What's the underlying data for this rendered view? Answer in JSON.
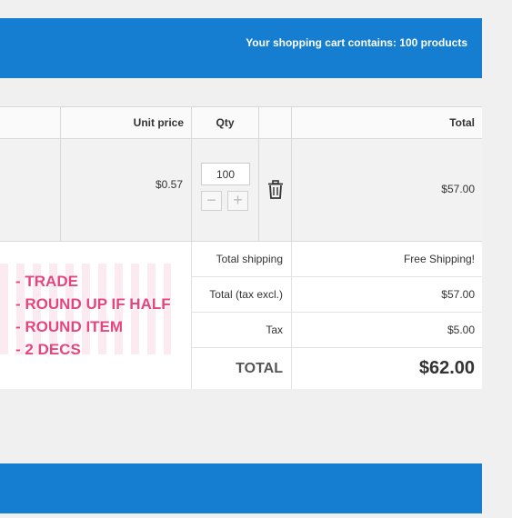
{
  "header": {
    "message": "Your shopping cart contains: 100 products"
  },
  "table": {
    "columns": {
      "unit_price": "Unit price",
      "qty": "Qty",
      "total": "Total"
    },
    "item": {
      "unit_price": "$0.57",
      "qty": "100",
      "total": "$57.00",
      "minus": "−",
      "plus": "+"
    },
    "summary": {
      "shipping_label": "Total shipping",
      "shipping_value": "Free Shipping!",
      "excl_label": "Total (tax excl.)",
      "excl_value": "$57.00",
      "tax_label": "Tax",
      "tax_value": "$5.00",
      "total_label": "TOTAL",
      "total_value": "$62.00"
    }
  },
  "annotation": {
    "lines": [
      "- TRADE",
      "- ROUND UP IF HALF",
      "- ROUND ITEM",
      "- 2 DECS"
    ],
    "color": "#e8447c"
  },
  "colors": {
    "banner": "#167ed1"
  }
}
